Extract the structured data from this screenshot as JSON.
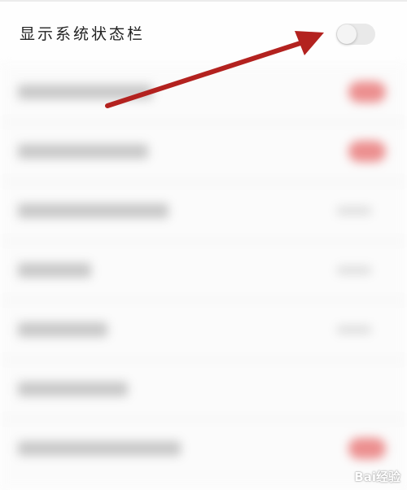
{
  "setting": {
    "title": "显示系统状态栏",
    "toggle_on": false
  },
  "annotation": {
    "arrow_color": "#b3221f",
    "target": "toggle"
  },
  "watermark": {
    "text": "Bai经验",
    "type": "logo"
  }
}
